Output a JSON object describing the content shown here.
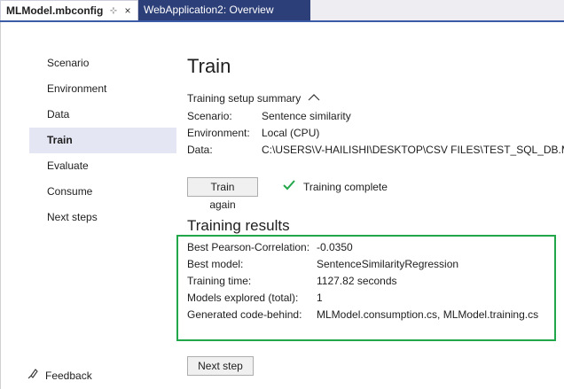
{
  "tabs": [
    {
      "label": "MLModel.mbconfig",
      "pin": "⊹",
      "close": "×"
    },
    {
      "label": "WebApplication2: Overview"
    }
  ],
  "nav": {
    "items": [
      "Scenario",
      "Environment",
      "Data",
      "Train",
      "Evaluate",
      "Consume",
      "Next steps"
    ],
    "selected": "Train",
    "feedback": "Feedback"
  },
  "main": {
    "title": "Train",
    "setup_summary": "Training setup summary",
    "setup": [
      {
        "key": "Scenario:",
        "value": "Sentence similarity"
      },
      {
        "key": "Environment:",
        "value": "Local (CPU)"
      },
      {
        "key": "Data:",
        "value": "C:\\USERS\\V-HAILISHI\\DESKTOP\\CSV FILES\\TEST_SQL_DB.MDF"
      }
    ],
    "train_again": "Train again",
    "status": "Training complete",
    "results_title": "Training results",
    "results": [
      {
        "key": "Best Pearson-Correlation:",
        "value": "-0.0350"
      },
      {
        "key": "Best model:",
        "value": "SentenceSimilarityRegression"
      },
      {
        "key": "Training time:",
        "value": "1127.82 seconds"
      },
      {
        "key": "Models explored (total):",
        "value": "1"
      },
      {
        "key": "Generated code-behind:",
        "value": "MLModel.consumption.cs, MLModel.training.cs"
      }
    ],
    "next_step": "Next step"
  },
  "colors": {
    "accent": "#2d3f78",
    "highlight": "#22a64a",
    "selected_bg": "#e4e6f4"
  },
  "icons": {
    "check": "check-icon",
    "feedback": "feedback-icon",
    "chevron": "chevron-up-icon"
  }
}
